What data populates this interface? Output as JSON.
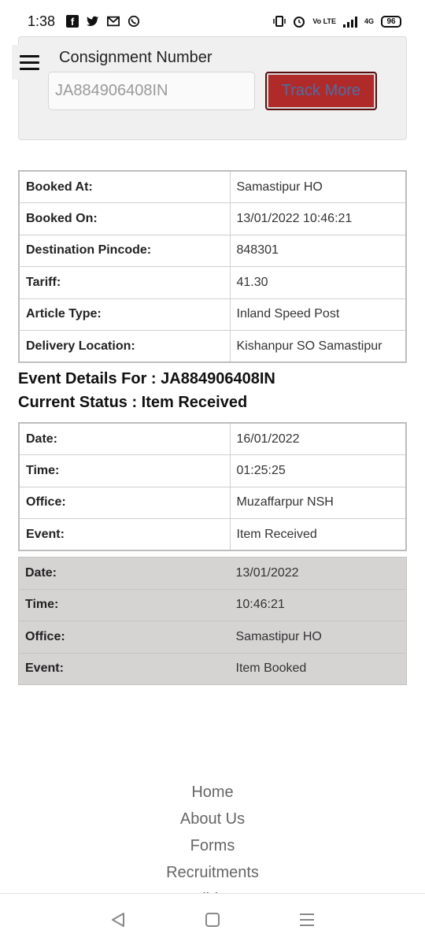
{
  "status_bar": {
    "time": "1:38",
    "network": "4G",
    "battery": "96",
    "volte": "Vo LTE"
  },
  "header": {
    "consignment_label": "Consignment Number",
    "consignment_value": "JA884906408IN",
    "track_button": "Track More"
  },
  "booking": {
    "rows": [
      {
        "key": "Booked At:",
        "value": "Samastipur HO"
      },
      {
        "key": "Booked On:",
        "value": "13/01/2022 10:46:21"
      },
      {
        "key": "Destination Pincode:",
        "value": "848301"
      },
      {
        "key": "Tariff:",
        "value": "41.30"
      },
      {
        "key": "Article Type:",
        "value": "Inland Speed Post"
      },
      {
        "key": "Delivery Location:",
        "value": "Kishanpur SO Samastipur"
      }
    ]
  },
  "events": {
    "title": "Event Details For : JA884906408IN",
    "status": "Current Status : Item Received",
    "list": [
      {
        "date_k": "Date:",
        "date": "16/01/2022",
        "time_k": "Time:",
        "time": "01:25:25",
        "office_k": "Office:",
        "office": "Muzaffarpur NSH",
        "event_k": "Event:",
        "event": "Item Received"
      },
      {
        "date_k": "Date:",
        "date": "13/01/2022",
        "time_k": "Time:",
        "time": "10:46:21",
        "office_k": "Office:",
        "office": "Samastipur HO",
        "event_k": "Event:",
        "event": "Item Booked"
      }
    ]
  },
  "footer": {
    "links": [
      "Home",
      "About Us",
      "Forms",
      "Recruitments",
      "Holidays"
    ]
  }
}
